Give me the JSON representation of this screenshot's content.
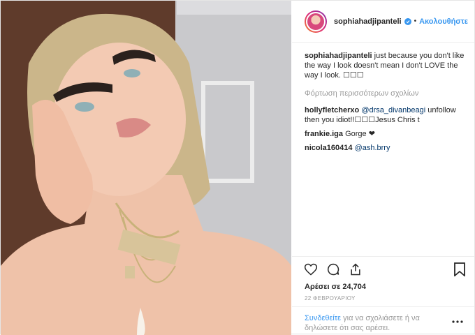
{
  "post": {
    "username": "sophiahadjipanteli",
    "follow_label": "Ακολουθήστε",
    "dot": "•",
    "caption_user": "sophiahadjipanteli",
    "caption_text": " just because you don't like the way I look doesn't mean I don't LOVE the way I look. ☐☐☐",
    "load_more": "Φόρτωση περισσότερων σχολίων",
    "comments": [
      {
        "user": "hollyfletcherxo",
        "mention": "@drsa_divanbeagi",
        "text": " unfollow then you idiot!!☐☐☐Jesus Chris t"
      },
      {
        "user": "frankie.iga",
        "mention": "",
        "text": " Gorge ❤"
      },
      {
        "user": "nicola160414",
        "mention": "@ash.brry",
        "text": ""
      }
    ],
    "likes": "Αρέσει σε 24,704",
    "date": "22 ΦΕΒΡΟΥΑΡΙΟΥ",
    "login_link": "Συνδεθείτε",
    "login_text": " για να σχολιάσετε ή να δηλώσετε ότι σας αρέσει."
  },
  "icons": {
    "like": "heart-icon",
    "comment": "comment-icon",
    "share": "share-icon",
    "save": "bookmark-icon",
    "more": "more-options-icon",
    "verified": "verified-badge-icon"
  },
  "colors": {
    "accent": "#3897f0",
    "muted": "#999999",
    "text": "#262626"
  }
}
